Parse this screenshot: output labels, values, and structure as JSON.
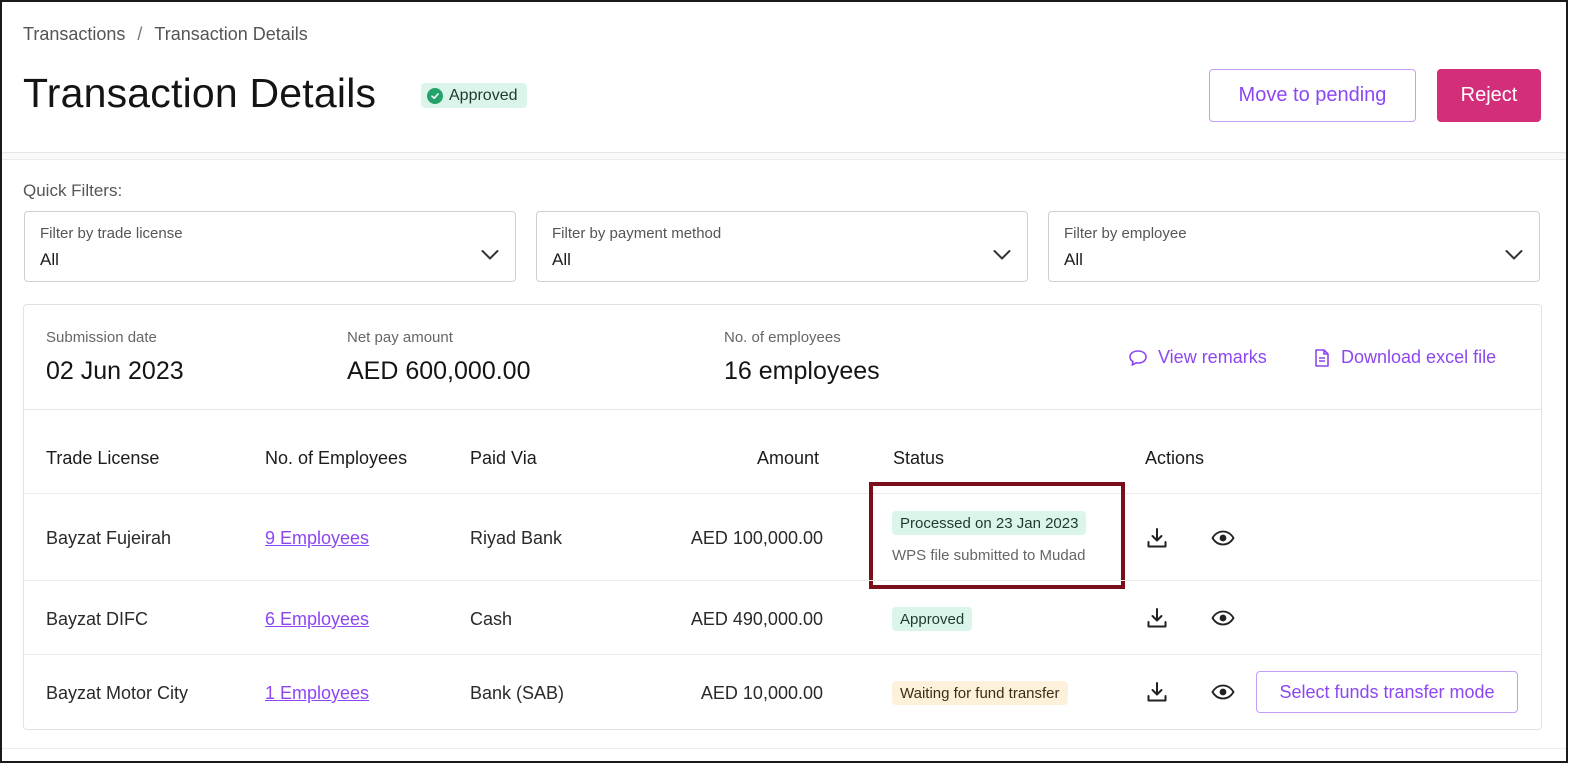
{
  "breadcrumb": {
    "parent": "Transactions",
    "separator": "/",
    "current": "Transaction Details"
  },
  "header": {
    "title": "Transaction Details",
    "status_badge": "Approved",
    "move_to_pending_label": "Move to pending",
    "reject_label": "Reject"
  },
  "filters": {
    "section_label": "Quick Filters:",
    "trade_license": {
      "label": "Filter by trade license",
      "value": "All"
    },
    "payment_method": {
      "label": "Filter by payment method",
      "value": "All"
    },
    "employee": {
      "label": "Filter by employee",
      "value": "All"
    }
  },
  "summary": {
    "submission_date": {
      "label": "Submission date",
      "value": "02 Jun 2023"
    },
    "net_pay": {
      "label": "Net pay amount",
      "value": "AED 600,000.00"
    },
    "employees": {
      "label": "No. of employees",
      "value": "16 employees"
    },
    "view_remarks_label": "View remarks",
    "download_excel_label": "Download excel file"
  },
  "table": {
    "columns": [
      "Trade License",
      "No. of Employees",
      "Paid Via",
      "Amount",
      "Status",
      "Actions"
    ],
    "rows": [
      {
        "trade_license": "Bayzat Fujeirah",
        "employees": "9 Employees",
        "paid_via": "Riyad Bank",
        "amount": "AED 100,000.00",
        "status": "Processed on 23 Jan 2023",
        "status_note": "WPS file submitted to Mudad",
        "status_color": "#dcf5ea"
      },
      {
        "trade_license": "Bayzat DIFC",
        "employees": "6 Employees",
        "paid_via": "Cash",
        "amount": "AED 490,000.00",
        "status": "Approved",
        "status_color": "#dcf5ea"
      },
      {
        "trade_license": "Bayzat Motor City",
        "employees": "1 Employees",
        "paid_via": "Bank (SAB)",
        "amount": "AED 10,000.00",
        "status": "Waiting for fund transfer",
        "status_color": "#fdf1dc",
        "action_label": "Select funds transfer mode"
      }
    ]
  },
  "colors": {
    "accent": "#8d47f2",
    "reject": "#d32e79",
    "success_bg": "#dcf5ea",
    "warning_bg": "#fdf1dc",
    "highlight": "#7a0e1c"
  }
}
